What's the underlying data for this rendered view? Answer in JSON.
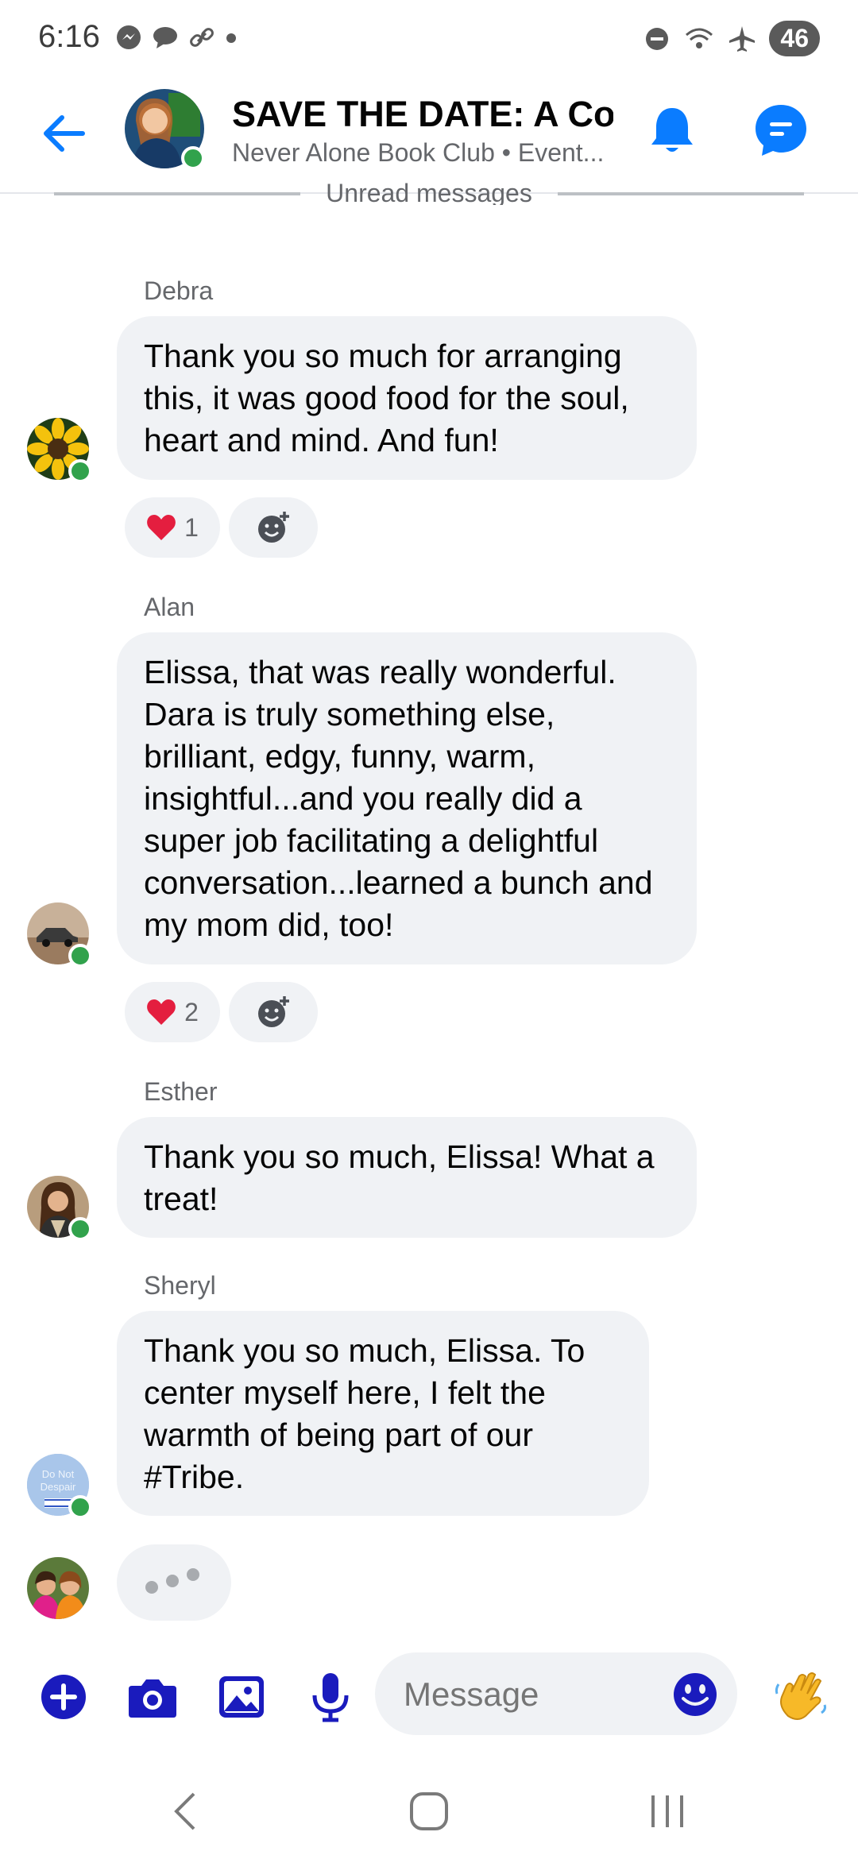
{
  "status_bar": {
    "time": "6:16",
    "battery": "46",
    "icons_left": [
      "messenger-icon",
      "chat-icon",
      "link-icon",
      "dot-icon"
    ],
    "icons_right": [
      "dnd-icon",
      "wifi-icon",
      "airplane-icon",
      "battery-icon"
    ]
  },
  "header": {
    "title": "SAVE THE DATE: A Co...",
    "subtitle": "Never Alone Book Club • Event...",
    "accent_color": "#0a7cff"
  },
  "divider": {
    "label": "Unread messages"
  },
  "messages": [
    {
      "sender": "Debra",
      "text": "Thank you so much for arranging this, it was good food for the soul, heart and mind. And fun!",
      "reaction_count": "1"
    },
    {
      "sender": "Alan",
      "text": "Elissa, that was really wonderful. Dara is truly something else, brilliant, edgy, funny, warm, insightful...and you really did a super job facilitating a delightful conversation...learned a bunch and my mom did, too!",
      "reaction_count": "2"
    },
    {
      "sender": "Esther",
      "text": "Thank you so much, Elissa! What a treat!"
    },
    {
      "sender": "Sheryl",
      "text": "Thank you so much, Elissa. To center myself here, I felt the warmth of being part of our #Tribe.",
      "avatar_text": "Do Not Despair"
    }
  ],
  "composer": {
    "placeholder": "Message",
    "icon_color": "#1a1bbd"
  }
}
